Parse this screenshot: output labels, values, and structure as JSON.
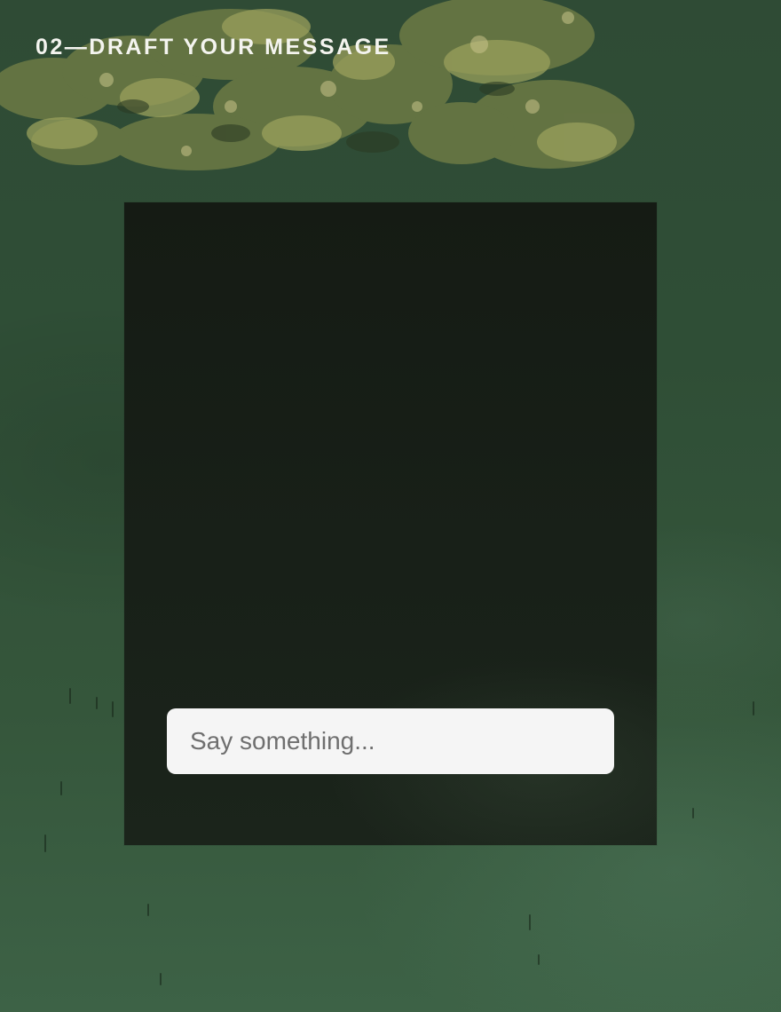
{
  "step": {
    "heading": "02—DRAFT YOUR MESSAGE"
  },
  "composer": {
    "value": "",
    "placeholder": "Say something..."
  },
  "colors": {
    "background_water": "#32513a",
    "panel": "#181f17",
    "input_background": "#f5f5f5",
    "heading_text": "#f4f4ef",
    "placeholder_text": "#6f6f6f"
  }
}
